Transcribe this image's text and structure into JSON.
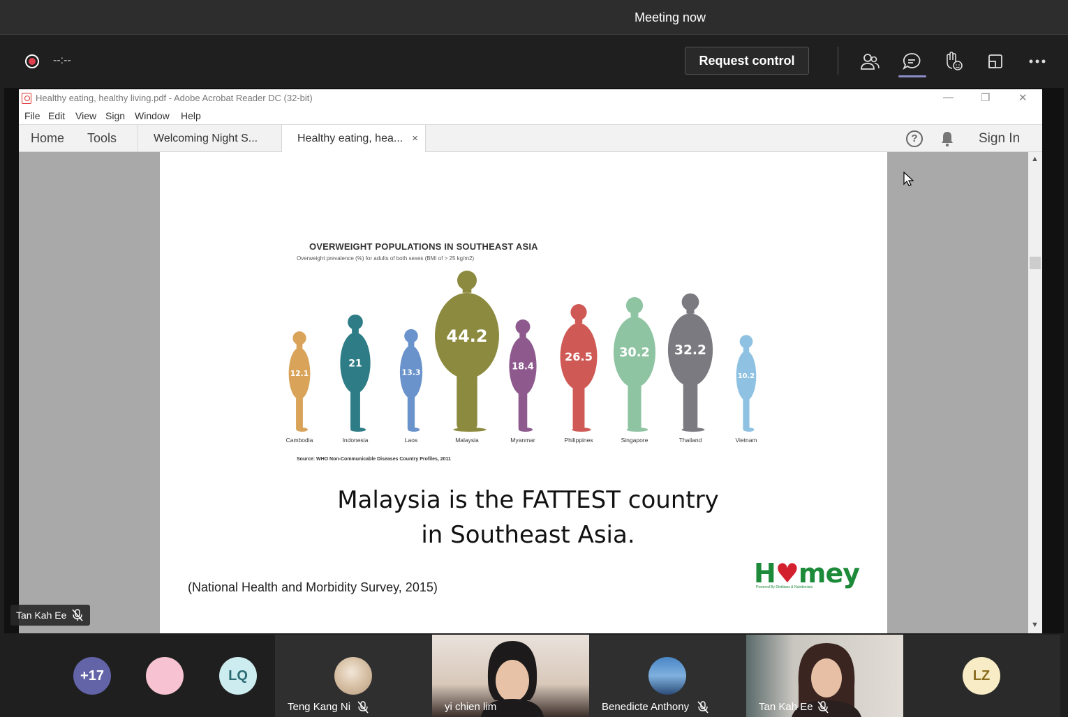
{
  "meeting": {
    "title": "Meeting now",
    "timer": "--:--",
    "request_control": "Request control"
  },
  "acrobat": {
    "window_title": "Healthy eating, healthy living.pdf - Adobe Acrobat Reader DC (32-bit)",
    "menu": [
      "File",
      "Edit",
      "View",
      "Sign",
      "Window",
      "Help"
    ],
    "home": "Home",
    "tools": "Tools",
    "tabs": [
      "Welcoming Night S...",
      "Healthy eating, hea..."
    ],
    "tab_close": "×",
    "sign_in": "Sign In",
    "help": "?"
  },
  "slide": {
    "source": "Source: WHO Non-Communicable Diseases Country Profiles, 2011",
    "headline_line1": "Malaysia is the FATTEST country",
    "headline_line2": "in Southeast Asia.",
    "citation": "(National Health and Morbidity Survey, 2015)",
    "logo_word_a": "H",
    "logo_word_heart": "♥",
    "logo_word_b": "mey",
    "logo_tagline": "Powered By Dietitians & Nutritionists"
  },
  "chart_data": {
    "type": "bar",
    "title": "OVERWEIGHT POPULATIONS IN SOUTHEAST ASIA",
    "subtitle": "Overweight prevalence (%) for adults of both sexes (BMI of > 25 kg/m2)",
    "categories": [
      "Cambodia",
      "Indonesia",
      "Laos",
      "Malaysia",
      "Myanmar",
      "Philippines",
      "Singapore",
      "Thailand",
      "Vietnam"
    ],
    "values": [
      12.1,
      21,
      13.3,
      44.2,
      18.4,
      26.5,
      30.2,
      32.2,
      10.2
    ],
    "value_labels": [
      "12.1",
      "21",
      "13.3",
      "44.2",
      "18.4",
      "26.5",
      "30.2",
      "32.2",
      "10.2"
    ],
    "colors": [
      "#d9a45a",
      "#2e7d86",
      "#6a93cc",
      "#8b8a3f",
      "#8e5a8e",
      "#cf5a55",
      "#8fc4a2",
      "#7a7a80",
      "#8fc2e2"
    ]
  },
  "presenter_tag": "Tan Kah Ee",
  "participants": [
    {
      "label": "+17",
      "color": "#6264a7",
      "text_color": "#ffffff"
    },
    {
      "label": "",
      "color": "#f7c3d3",
      "text_color": "#ffffff"
    },
    {
      "label": "LQ",
      "color": "#cdecef",
      "text_color": "#2b6b73"
    },
    {
      "name": "Teng Kang Ni"
    },
    {
      "name": "yi chien lim"
    },
    {
      "name": "Benedicte Anthony"
    },
    {
      "name": "Tan Kah Ee"
    },
    {
      "label": "LZ",
      "color": "#f8ecc6",
      "text_color": "#8a6d1f"
    }
  ]
}
